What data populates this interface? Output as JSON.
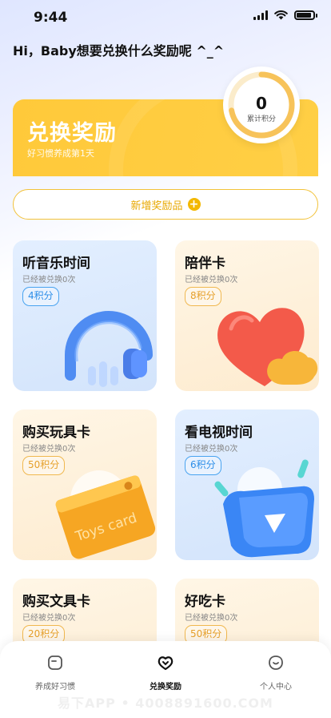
{
  "status_bar": {
    "time": "9:44"
  },
  "greeting": "Hi，Baby想要兑换什么奖励呢 ^_^",
  "banner": {
    "title": "兑换奖励",
    "subtitle": "好习惯养成第1天"
  },
  "points": {
    "value": "0",
    "label": "累计积分",
    "ring_color": "#f7c35a",
    "progress": 0.72
  },
  "add_button": {
    "label": "新增奖励品"
  },
  "rewards": [
    {
      "title": "听音乐时间",
      "count": "已经被兑换0次",
      "points": "4积分",
      "theme": "blue"
    },
    {
      "title": "陪伴卡",
      "count": "已经被兑换0次",
      "points": "8积分",
      "theme": "cream"
    },
    {
      "title": "购买玩具卡",
      "count": "已经被兑换0次",
      "points": "50积分",
      "theme": "cream",
      "art_text": "Toys card"
    },
    {
      "title": "看电视时间",
      "count": "已经被兑换0次",
      "points": "6积分",
      "theme": "blue"
    },
    {
      "title": "购买文具卡",
      "count": "已经被兑换0次",
      "points": "20积分",
      "theme": "cream"
    },
    {
      "title": "好吃卡",
      "count": "已经被兑换0次",
      "points": "50积分",
      "theme": "cream"
    }
  ],
  "tabs": [
    {
      "label": "养成好习惯",
      "icon": "habit-icon",
      "active": false
    },
    {
      "label": "兑换奖励",
      "icon": "reward-icon",
      "active": true
    },
    {
      "label": "个人中心",
      "icon": "profile-icon",
      "active": false
    }
  ],
  "watermark": "易下APP • 4008891600.COM"
}
